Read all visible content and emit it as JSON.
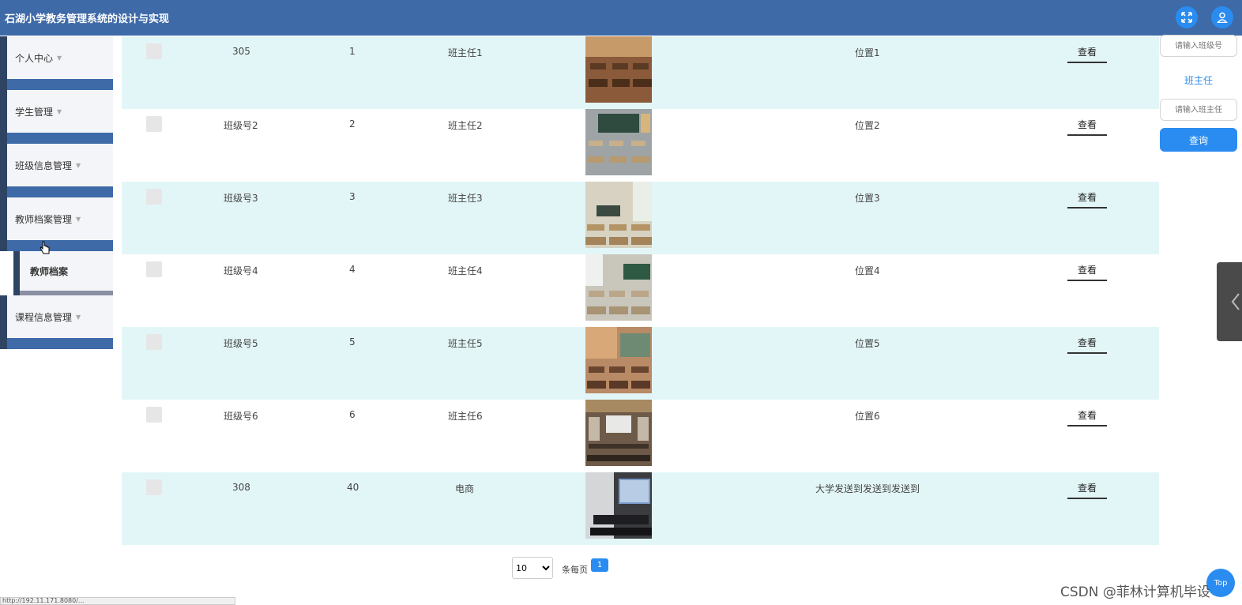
{
  "header": {
    "title": "石湖小学教务管理系统的设计与实现"
  },
  "sidebar": {
    "items": [
      {
        "label": "个人中心"
      },
      {
        "label": "学生管理"
      },
      {
        "label": "班级信息管理"
      },
      {
        "label": "教师档案管理",
        "children": [
          {
            "label": "教师档案"
          }
        ]
      },
      {
        "label": "课程信息管理"
      }
    ]
  },
  "table": {
    "view_label": "查看",
    "rows": [
      {
        "class_no": "305",
        "count": "1",
        "teacher": "班主任1",
        "location": "位置1"
      },
      {
        "class_no": "班级号2",
        "count": "2",
        "teacher": "班主任2",
        "location": "位置2"
      },
      {
        "class_no": "班级号3",
        "count": "3",
        "teacher": "班主任3",
        "location": "位置3"
      },
      {
        "class_no": "班级号4",
        "count": "4",
        "teacher": "班主任4",
        "location": "位置4"
      },
      {
        "class_no": "班级号5",
        "count": "5",
        "teacher": "班主任5",
        "location": "位置5"
      },
      {
        "class_no": "班级号6",
        "count": "6",
        "teacher": "班主任6",
        "location": "位置6"
      },
      {
        "class_no": "308",
        "count": "40",
        "teacher": "电商",
        "location": "大学发送到发送到发送到"
      }
    ]
  },
  "search": {
    "class_placeholder": "请输入班级号",
    "teacher_label": "班主任",
    "teacher_placeholder": "请输入班主任",
    "button_label": "查询"
  },
  "pagination": {
    "page_size": "10",
    "page_size_options": [
      "10"
    ],
    "per_page_label": "条每页",
    "current_page": "1"
  },
  "fab_label": "Top",
  "watermark": "CSDN @菲林计算机毕设",
  "status_url": "http://192.11.171.8080/...",
  "colors": {
    "header": "#3e6aa8",
    "accent": "#2a8cf0",
    "row_alt": "#e3f6f7"
  }
}
